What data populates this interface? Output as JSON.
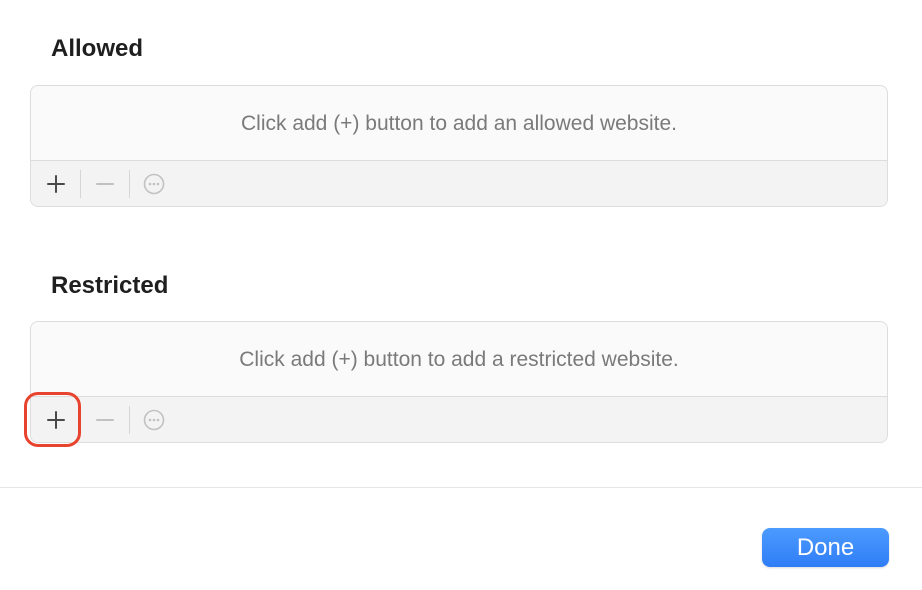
{
  "allowed": {
    "title": "Allowed",
    "empty_message": "Click add (+) button to add an allowed website."
  },
  "restricted": {
    "title": "Restricted",
    "empty_message": "Click add (+) button to add a restricted website."
  },
  "toolbar_icons": [
    "plus-icon",
    "minus-icon",
    "ellipsis-circle-icon"
  ],
  "footer": {
    "done_label": "Done"
  },
  "colors": {
    "accent": "#2f7df6",
    "highlight": "#e8432e"
  }
}
